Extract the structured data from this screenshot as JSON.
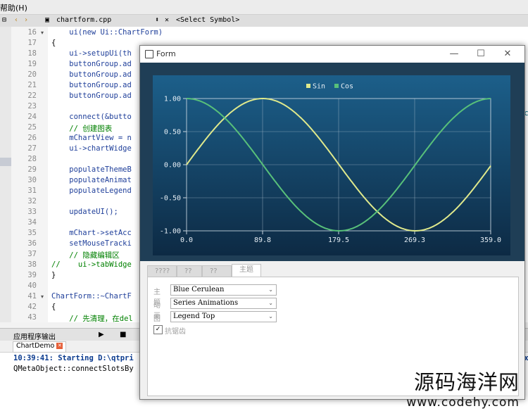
{
  "menubar": {
    "help": "帮助(H)"
  },
  "editor": {
    "file_name": "chartform.cpp",
    "symbol_select": "<Select Symbol>",
    "close_symbol": "✕"
  },
  "code_lines": [
    {
      "n": "16",
      "fold": "▾",
      "text": "    ui(new Ui::ChartForm)"
    },
    {
      "n": "17",
      "fold": "",
      "text": "{"
    },
    {
      "n": "18",
      "fold": "",
      "text": "    ui->setupUi(th"
    },
    {
      "n": "19",
      "fold": "",
      "text": "    buttonGroup.ad"
    },
    {
      "n": "20",
      "fold": "",
      "text": "    buttonGroup.ad"
    },
    {
      "n": "21",
      "fold": "",
      "text": "    buttonGroup.ad"
    },
    {
      "n": "22",
      "fold": "",
      "text": "    buttonGroup.ad"
    },
    {
      "n": "23",
      "fold": "",
      "text": ""
    },
    {
      "n": "24",
      "fold": "",
      "text": "    connect(&butto"
    },
    {
      "n": "25",
      "fold": "",
      "text": "    // 创建图表"
    },
    {
      "n": "26",
      "fold": "",
      "text": "    mChartView = n"
    },
    {
      "n": "27",
      "fold": "",
      "text": "    ui->chartWidge"
    },
    {
      "n": "28",
      "fold": "",
      "text": ""
    },
    {
      "n": "29",
      "fold": "",
      "text": "    populateThemeB"
    },
    {
      "n": "30",
      "fold": "",
      "text": "    populateAnimat"
    },
    {
      "n": "31",
      "fold": "",
      "text": "    populateLegend"
    },
    {
      "n": "32",
      "fold": "",
      "text": ""
    },
    {
      "n": "33",
      "fold": "",
      "text": "    updateUI();"
    },
    {
      "n": "34",
      "fold": "",
      "text": ""
    },
    {
      "n": "35",
      "fold": "",
      "text": "    mChart->setAcc"
    },
    {
      "n": "36",
      "fold": "",
      "text": "    setMouseTracki"
    },
    {
      "n": "37",
      "fold": "",
      "text": "    // 隐藏编辑区"
    },
    {
      "n": "38",
      "fold": "",
      "text": "//    ui->tabWidge"
    },
    {
      "n": "39",
      "fold": "",
      "text": "}"
    },
    {
      "n": "40",
      "fold": "",
      "text": ""
    },
    {
      "n": "41",
      "fold": "▾",
      "text": "ChartForm::~ChartF"
    },
    {
      "n": "42",
      "fold": "",
      "text": "{"
    },
    {
      "n": "43",
      "fold": "",
      "text": "    // 先清理，在del"
    }
  ],
  "code_overflow": "oc",
  "bottom": {
    "panel_title": "应用程序输出",
    "tab": "ChartDemo",
    "line1": "10:39:41: Starting D:\\qtpri",
    "line1_tail": "ex",
    "line2": "QMetaObject::connectSlotsBy"
  },
  "form": {
    "title": "Form",
    "minimize": "—",
    "maximize": "☐",
    "close": "✕",
    "tabs": [
      "????",
      "??",
      "??",
      "主题"
    ],
    "theme_label": "主题",
    "theme_value": "Blue Cerulean",
    "animation_label": "动画",
    "animation_value": "Series Animations",
    "legend_label": "图例",
    "legend_value": "Legend Top",
    "antialias_label": "抗锯齿",
    "antialias_checked": true
  },
  "chart_data": {
    "type": "line",
    "x_ticks": [
      "0.0",
      "89.8",
      "179.5",
      "269.3",
      "359.0"
    ],
    "y_ticks": [
      "1.00",
      "0.50",
      "0.00",
      "-0.50",
      "-1.00"
    ],
    "xlim": [
      0,
      359
    ],
    "ylim": [
      -1,
      1
    ],
    "grid": true,
    "legend_position": "top",
    "series": [
      {
        "name": "Sin",
        "color": "#dfe98c",
        "function": "sin",
        "x": [
          0,
          45,
          90,
          135,
          180,
          225,
          270,
          315,
          359
        ],
        "values": [
          0.0,
          0.71,
          1.0,
          0.71,
          0.0,
          -0.71,
          -1.0,
          -0.71,
          -0.02
        ]
      },
      {
        "name": "Cos",
        "color": "#58c07a",
        "function": "cos",
        "x": [
          0,
          45,
          90,
          135,
          180,
          225,
          270,
          315,
          359
        ],
        "values": [
          1.0,
          0.71,
          0.0,
          -0.71,
          -1.0,
          -0.71,
          0.0,
          0.71,
          1.0
        ]
      }
    ],
    "background_top": "#1c5f8a",
    "background_bottom": "#0d2a44"
  },
  "watermark": {
    "line1": "源码海洋网",
    "line2": "www.codehy.com"
  }
}
